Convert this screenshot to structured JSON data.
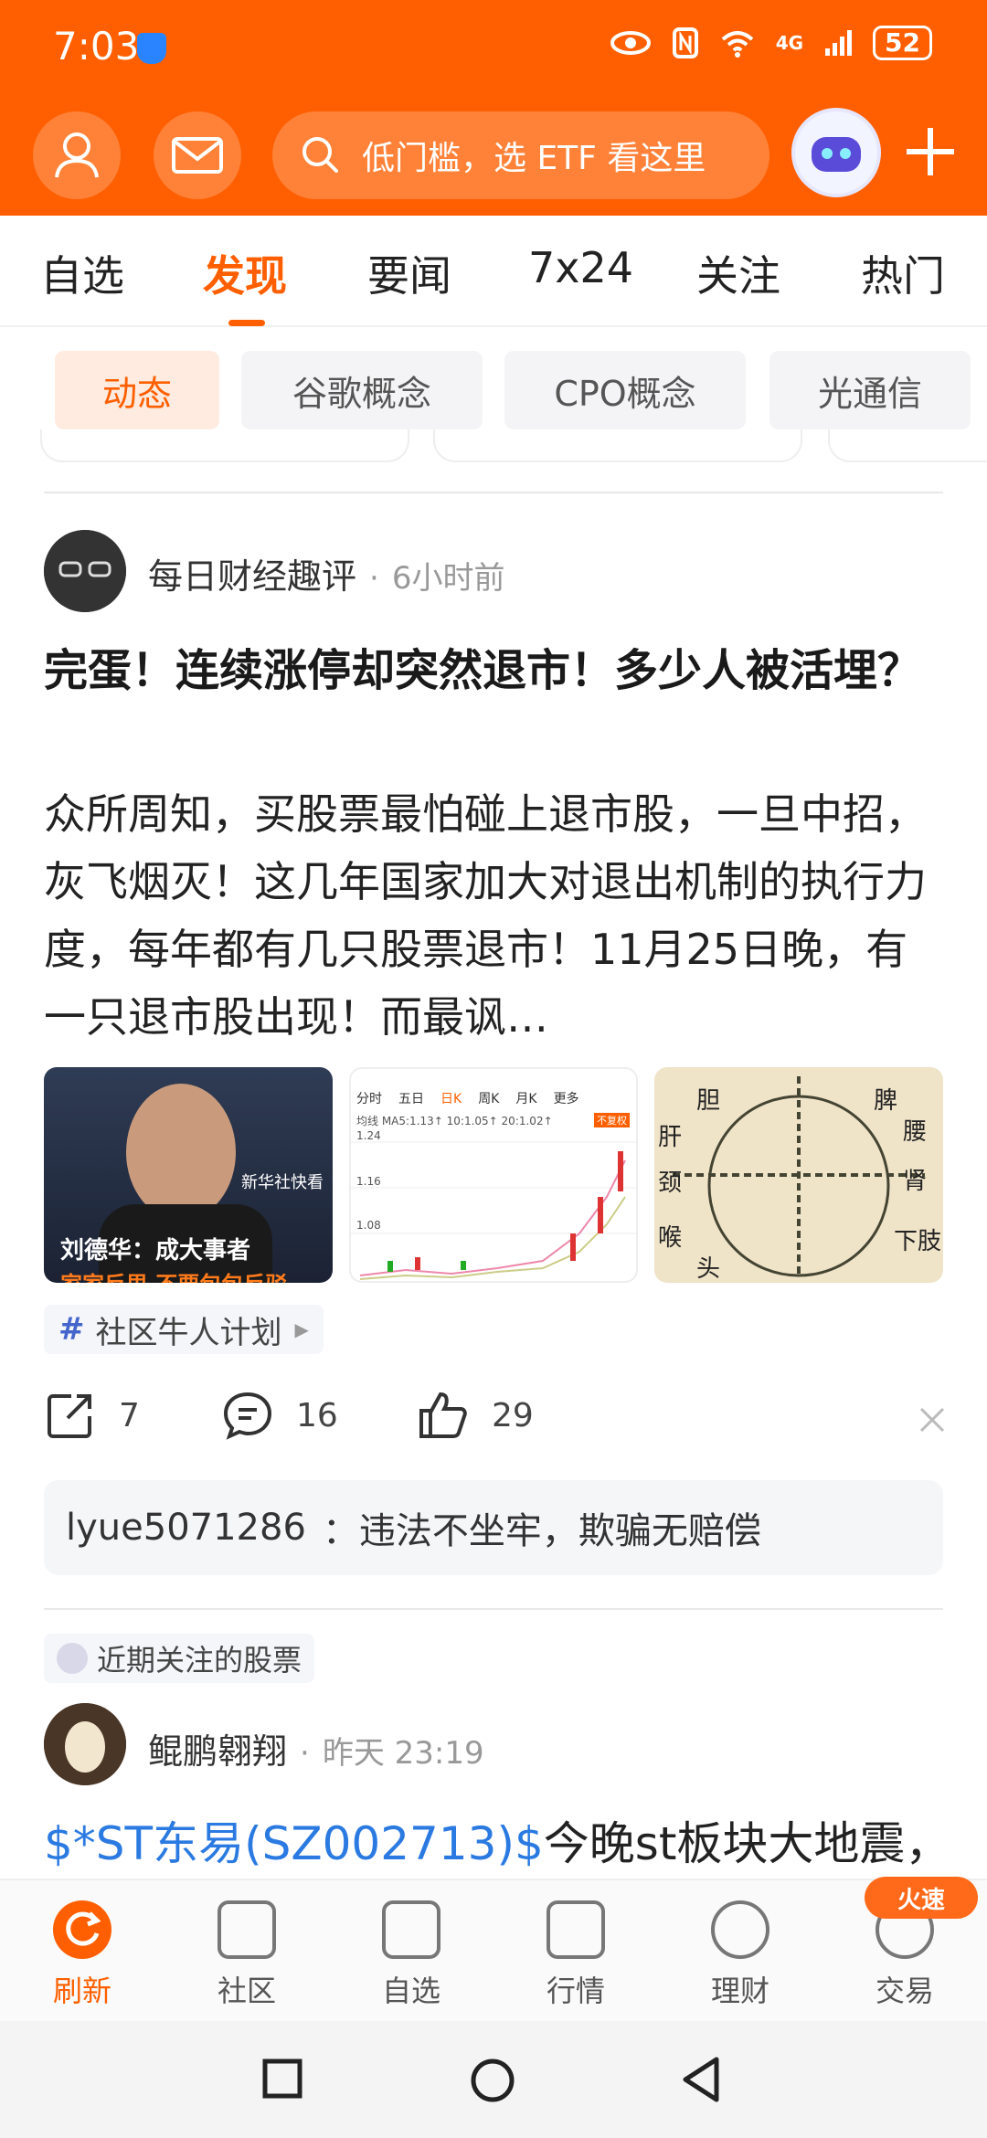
{
  "status": {
    "time": "7:03",
    "battery": "52",
    "network": "4G"
  },
  "header": {
    "search_placeholder": "低门槛，选 ETF 看这里"
  },
  "tabs": [
    "自选",
    "发现",
    "要闻",
    "7x24",
    "关注",
    "热门"
  ],
  "chips": [
    "动态",
    "谷歌概念",
    "CPO概念",
    "光通信"
  ],
  "post": {
    "author": "每日财经趣评",
    "time": "6小时前",
    "title": "完蛋！连续涨停却突然退市！多少人被活埋？",
    "body": "众所周知，买股票最怕碰上退市股，一旦中招，灰飞烟灭！这几年国家加大对退出机制的执行力度，每年都有几只股票退市！11月25日晚，有一只退市股出现！而最讽…",
    "images": {
      "img1_caption": "刘德华：成大事者",
      "img1_subcaption": "家家反思 不要包包反驳",
      "img1_watermark": "新华社快看",
      "img2_tabs": [
        "分时",
        "五日",
        "日K",
        "周K",
        "月K",
        "更多"
      ],
      "img2_legend": "均线 MA5:1.13↑ 10:1.05↑ 20:1.02↑",
      "img2_yticks": [
        "1.24",
        "1.16",
        "1.08"
      ],
      "img2_badge": "不复权",
      "img3_labels": [
        "胆",
        "脾",
        "肝",
        "腰",
        "肾",
        "颈",
        "喉",
        "下肢",
        "头"
      ]
    },
    "topic_tag": "社区牛人计划",
    "actions": {
      "share": "7",
      "comment": "16",
      "like": "29"
    },
    "comment": {
      "user": "lyue5071286",
      "text": "：违法不坐牢，欺骗无赔偿"
    }
  },
  "recent_label": "近期关注的股票",
  "post2": {
    "author": "鲲鹏翱翔",
    "time": "昨天 23:19",
    "stock_link": "$*ST东易(SZ002713)$",
    "text": "今晚st板块大地震，"
  },
  "bottom_nav": [
    "刷新",
    "社区",
    "自选",
    "行情",
    "理财",
    "交易"
  ],
  "hot_badge": "火速",
  "colors": {
    "accent": "#ff5f00",
    "link": "#2a7ae2"
  }
}
